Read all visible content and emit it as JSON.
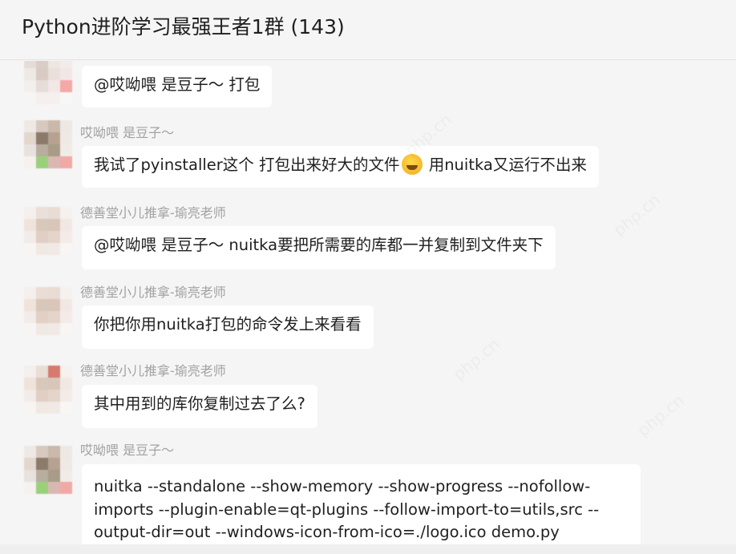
{
  "window": {
    "title": "Python进阶学习最强王者1群 (143)"
  },
  "messages": [
    {
      "sender": "",
      "text": "@哎呦喂  是豆子～ 打包"
    },
    {
      "sender": "哎呦喂  是豆子～",
      "text_before": "我试了pyinstaller这个  打包出来好大的文件",
      "emoji": "laughing-crying-emoji",
      "text_after": "  用nuitka又运行不出来"
    },
    {
      "sender": "德善堂小儿推拿-瑜亮老师",
      "text": "@哎呦喂  是豆子～ nuitka要把所需要的库都一并复制到文件夹下"
    },
    {
      "sender": "德善堂小儿推拿-瑜亮老师",
      "text": "你把你用nuitka打包的命令发上来看看"
    },
    {
      "sender": "德善堂小儿推拿-瑜亮老师",
      "text": "其中用到的库你复制过去了么?"
    },
    {
      "sender": "哎呦喂  是豆子～",
      "text": "nuitka --standalone --show-memory --show-progress --nofollow-imports --plugin-enable=qt-plugins --follow-import-to=utils,src --output-dir=out --windows-icon-from-ico=./logo.ico demo.py"
    }
  ],
  "colors": {
    "background": "#f5f5f5",
    "bubble": "#ffffff",
    "sender": "#a2a2a2",
    "text": "#1f1f1f"
  }
}
